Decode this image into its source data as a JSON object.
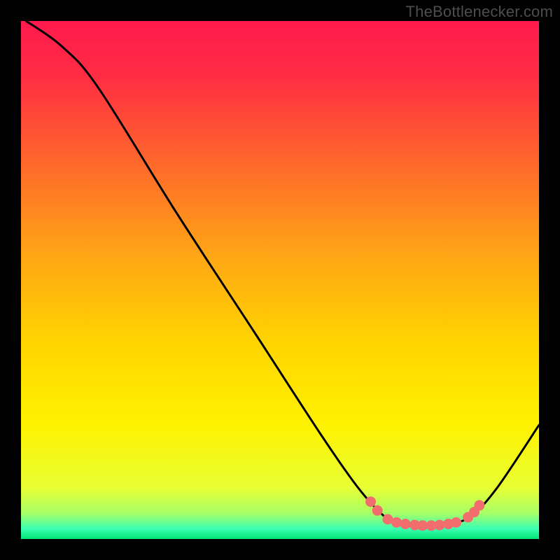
{
  "watermark": "TheBottlenecker.com",
  "chart_data": {
    "type": "line",
    "title": "",
    "xlabel": "",
    "ylabel": "",
    "xlim": [
      0,
      100
    ],
    "ylim": [
      0,
      100
    ],
    "background_gradient": {
      "top": "#ff1a4d",
      "mid": "#ffe100",
      "bottom": "#00e676"
    },
    "series": [
      {
        "name": "curve",
        "points": [
          {
            "x": 1,
            "y": 100
          },
          {
            "x": 8,
            "y": 95
          },
          {
            "x": 15,
            "y": 87
          },
          {
            "x": 30,
            "y": 63
          },
          {
            "x": 45,
            "y": 40
          },
          {
            "x": 58,
            "y": 20
          },
          {
            "x": 65,
            "y": 10
          },
          {
            "x": 70,
            "y": 4.5
          },
          {
            "x": 73,
            "y": 3
          },
          {
            "x": 78,
            "y": 2.5
          },
          {
            "x": 83,
            "y": 3
          },
          {
            "x": 87,
            "y": 4.5
          },
          {
            "x": 92,
            "y": 10
          },
          {
            "x": 100,
            "y": 22
          }
        ]
      }
    ],
    "markers": [
      {
        "x": 67.5,
        "y": 7.2
      },
      {
        "x": 68.8,
        "y": 5.5
      },
      {
        "x": 70.8,
        "y": 3.8
      },
      {
        "x": 72.5,
        "y": 3.2
      },
      {
        "x": 74.2,
        "y": 2.9
      },
      {
        "x": 76.0,
        "y": 2.7
      },
      {
        "x": 77.5,
        "y": 2.6
      },
      {
        "x": 79.2,
        "y": 2.6
      },
      {
        "x": 80.8,
        "y": 2.7
      },
      {
        "x": 82.5,
        "y": 2.9
      },
      {
        "x": 84.0,
        "y": 3.2
      },
      {
        "x": 86.3,
        "y": 4.2
      },
      {
        "x": 87.5,
        "y": 5.2
      },
      {
        "x": 88.5,
        "y": 6.5
      }
    ],
    "marker_color": "#f26d6d",
    "curve_color": "#000000"
  }
}
